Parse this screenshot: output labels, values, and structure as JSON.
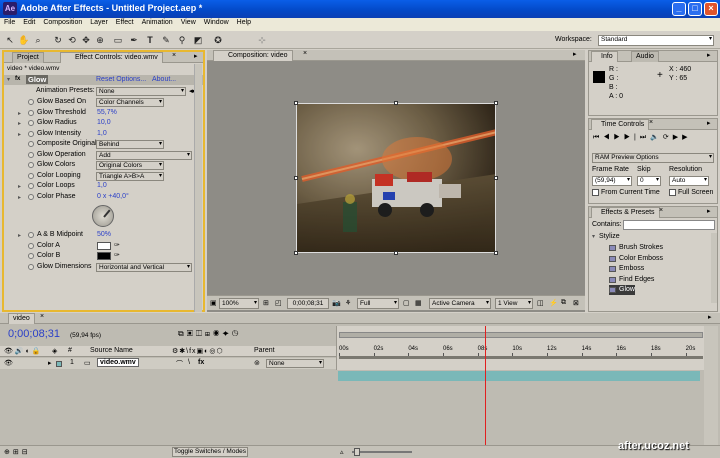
{
  "window": {
    "title": "Adobe After Effects - Untitled Project.aep *"
  },
  "menu": [
    "File",
    "Edit",
    "Composition",
    "Layer",
    "Effect",
    "Animation",
    "View",
    "Window",
    "Help"
  ],
  "toolbar": {
    "workspace_label": "Workspace:",
    "workspace_value": "Standard"
  },
  "project_tabs": {
    "project": "Project",
    "effect_controls": "Effect Controls: video.wmv"
  },
  "effect_controls": {
    "breadcrumb": "video * video.wmv",
    "effect_name": "Glow",
    "reset": "Reset Options...",
    "about": "About...",
    "presets_label": "Animation Presets:",
    "presets_value": "None",
    "params": [
      {
        "label": "Glow Based On",
        "value": "Color Channels",
        "kind": "select"
      },
      {
        "label": "Glow Threshold",
        "value": "55,7%",
        "kind": "num"
      },
      {
        "label": "Glow Radius",
        "value": "10,0",
        "kind": "num"
      },
      {
        "label": "Glow Intensity",
        "value": "1,0",
        "kind": "num"
      },
      {
        "label": "Composite Original",
        "value": "Behind",
        "kind": "select"
      },
      {
        "label": "Glow Operation",
        "value": "Add",
        "kind": "select"
      },
      {
        "label": "Glow Colors",
        "value": "Original Colors",
        "kind": "select"
      },
      {
        "label": "Color Looping",
        "value": "Triangle A>B>A",
        "kind": "select"
      },
      {
        "label": "Color Loops",
        "value": "1,0",
        "kind": "num"
      },
      {
        "label": "Color Phase",
        "value": "0 x +40,0°",
        "kind": "num"
      }
    ],
    "params2": [
      {
        "label": "A & B Midpoint",
        "value": "50%",
        "kind": "num"
      },
      {
        "label": "Color A",
        "value": "",
        "kind": "colorA"
      },
      {
        "label": "Color B",
        "value": "",
        "kind": "colorB"
      },
      {
        "label": "Glow Dimensions",
        "value": "Horizontal and Vertical",
        "kind": "select"
      }
    ]
  },
  "composition": {
    "tab": "Composition: video",
    "zoom": "100%",
    "timecode": "0;00;08;31",
    "resolution": "Full",
    "camera": "Active Camera",
    "view": "1 View"
  },
  "info": {
    "tab_info": "Info",
    "tab_audio": "Audio",
    "r": "R :",
    "g": "G :",
    "b": "B :",
    "a": "A : 0",
    "x": "X : 460",
    "y": "Y : 65"
  },
  "time_controls": {
    "tab": "Time Controls",
    "preview": "RAM Preview Options",
    "frame_rate_label": "Frame Rate",
    "frame_rate": "(59,94)",
    "skip_label": "Skip",
    "skip": "0",
    "resolution_label": "Resolution",
    "resolution": "Auto",
    "from_current": "From Current Time",
    "full_screen": "Full Screen"
  },
  "effects_presets": {
    "tab": "Effects & Presets",
    "contains_label": "Contains:",
    "category": "Stylize",
    "items": [
      "Brush Strokes",
      "Color Emboss",
      "Emboss",
      "Find Edges",
      "Glow"
    ]
  },
  "timeline": {
    "tab": "video",
    "timecode": "0;00;08;31",
    "fps": "(59,94 fps)",
    "source_name_header": "Source Name",
    "parent_header": "Parent",
    "layer_num": "1",
    "layer_name": "video.wmv",
    "parent_value": "None",
    "ticks": [
      "00s",
      "02s",
      "04s",
      "06s",
      "08s",
      "10s",
      "12s",
      "14s",
      "16s",
      "18s",
      "20s"
    ],
    "toggle_label": "Toggle Switches / Modes",
    "playhead_seconds": 8.5,
    "duration_seconds": 21
  },
  "watermark": "after.ucoz.net"
}
